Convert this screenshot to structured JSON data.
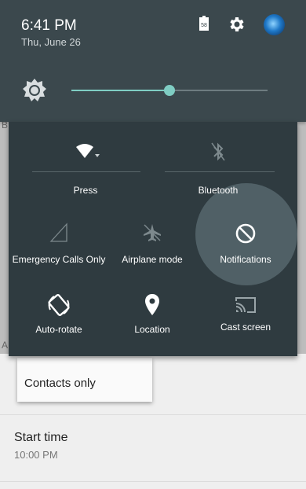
{
  "status": {
    "time": "6:41 PM",
    "date": "Thu, June 26",
    "battery_level": "58"
  },
  "brightness": {
    "level": 0.5
  },
  "tiles": {
    "wifi": "Press",
    "bluetooth": "Bluetooth",
    "emergency": "Emergency Calls Only",
    "airplane": "Airplane mode",
    "notifications": "Notifications",
    "rotate": "Auto-rotate",
    "location": "Location",
    "cast": "Cast screen"
  },
  "background": {
    "popup_option": "Contacts only",
    "start_time_title": "Start time",
    "start_time_value": "10:00 PM",
    "letter_b": "B",
    "letter_a": "A"
  },
  "colors": {
    "shade": "#3b484d",
    "panel": "#2f3b40",
    "accent": "#7fcdc3"
  }
}
